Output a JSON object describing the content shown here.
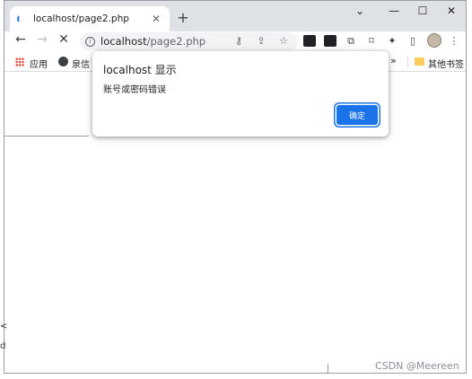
{
  "tab": {
    "title": "localhost/page2.php",
    "close": "✕"
  },
  "new_tab": "+",
  "window_controls": {
    "minimize": "⌄",
    "min": "—",
    "max": "☐",
    "close": "✕"
  },
  "nav": {
    "back": "←",
    "forward": "→",
    "stop": "✕"
  },
  "omnibox": {
    "host": "localhost",
    "path": "/page2.php",
    "info": "i"
  },
  "omnibox_icons": {
    "key": "⚷",
    "share": "⇪",
    "star": "☆"
  },
  "extensions": {
    "puzzle": "✦",
    "sidepanel": "▯",
    "menu": "⋮",
    "more": "»",
    "bookmark": "⌑",
    "copy": "⧉"
  },
  "bookmarks": {
    "apps": "应用",
    "item1": "泉信",
    "other": "其他书签"
  },
  "dialog": {
    "title": "localhost 显示",
    "message": "账号或密码错误",
    "ok_label": "确定"
  },
  "page_fragments": {
    "lt": "<",
    "d": "d"
  },
  "watermark": "CSDN @Meereen"
}
